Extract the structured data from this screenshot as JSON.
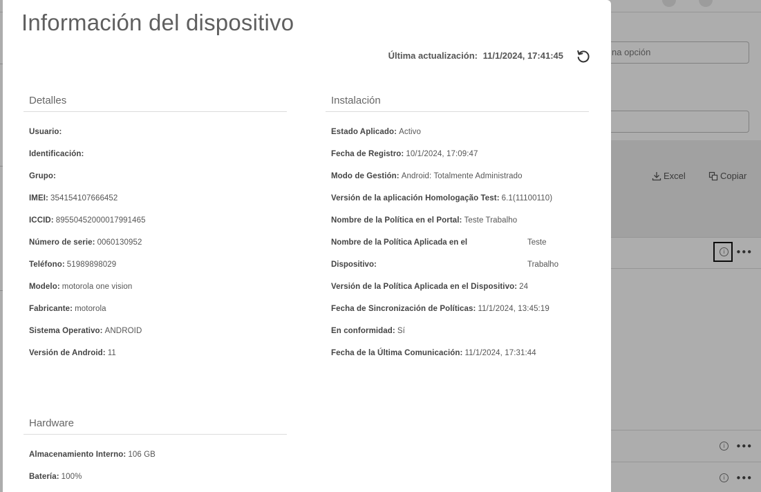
{
  "background": {
    "search_input_text": "na opción",
    "export_excel_label": "Excel",
    "copy_label": "Copiar"
  },
  "modal": {
    "title": "Información del dispositivo",
    "last_update_label": "Última actualización:",
    "last_update_value": "11/1/2024, 17:41:45"
  },
  "details": {
    "title": "Detalles",
    "rows": [
      {
        "label": "Usuario:",
        "value": ""
      },
      {
        "label": "Identificación:",
        "value": ""
      },
      {
        "label": "Grupo:",
        "value": ""
      },
      {
        "label": "IMEI:",
        "value": "354154107666452"
      },
      {
        "label": "ICCID:",
        "value": "89550452000017991465"
      },
      {
        "label": "Número de serie:",
        "value": "0060130952"
      },
      {
        "label": "Teléfono:",
        "value": "51989898029"
      },
      {
        "label": "Modelo:",
        "value": "motorola one vision"
      },
      {
        "label": "Fabricante:",
        "value": "motorola"
      },
      {
        "label": "Sistema Operativo:",
        "value": "ANDROID"
      },
      {
        "label": "Versión de Android:",
        "value": "11"
      }
    ]
  },
  "installation": {
    "title": "Instalación",
    "rows_top": [
      {
        "label": "Estado Aplicado:",
        "value": "Activo"
      },
      {
        "label": "Fecha de Registro:",
        "value": "10/1/2024, 17:09:47"
      },
      {
        "label": "Modo de Gestión:",
        "value": "Android: Totalmente Administrado"
      },
      {
        "label": "Versión de la aplicación Homologação Test:",
        "value": "6.1(11100110)"
      },
      {
        "label": "Nombre de la Política en el Portal:",
        "value": "Teste Trabalho"
      }
    ],
    "applied_policy": {
      "label_line1": "Nombre de la Política Aplicada en el",
      "label_line2": "Dispositivo:",
      "value_line1": "Teste",
      "value_line2": "Trabalho"
    },
    "rows_bottom": [
      {
        "label": "Versión de la Política Aplicada en el Dispositivo:",
        "value": "24"
      },
      {
        "label": "Fecha de Sincronización de Políticas:",
        "value": "11/1/2024, 13:45:19"
      },
      {
        "label": "En conformidad:",
        "value": "Sí"
      },
      {
        "label": "Fecha de la Última Comunicación:",
        "value": "11/1/2024, 17:31:44"
      }
    ]
  },
  "hardware": {
    "title": "Hardware",
    "rows": [
      {
        "label": "Almacenamiento Interno:",
        "value": "106 GB"
      },
      {
        "label": "Batería:",
        "value": "100%"
      }
    ]
  },
  "icons": {
    "refresh": "refresh-icon",
    "info": "info-icon",
    "more": "more-icon",
    "download": "download-icon",
    "copy": "copy-icon"
  }
}
